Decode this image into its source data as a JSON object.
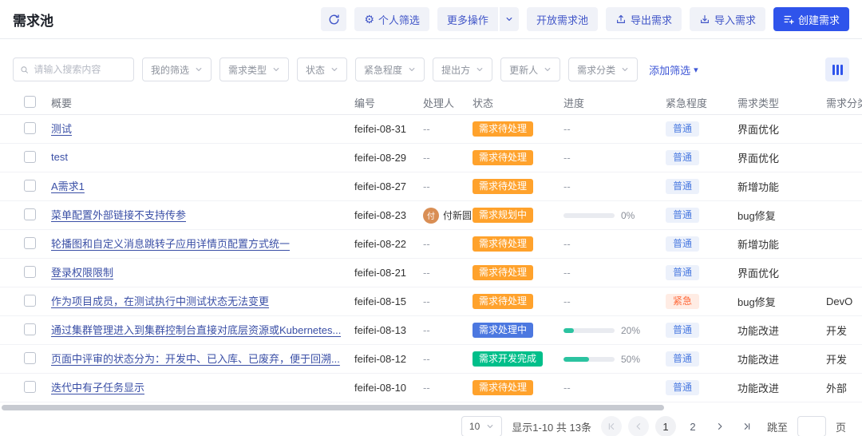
{
  "header": {
    "title": "需求池",
    "personal_filter": "个人筛选",
    "more_actions": "更多操作",
    "open_pool": "开放需求池",
    "export": "导出需求",
    "import": "导入需求",
    "create": "创建需求"
  },
  "filter_bar": {
    "search_placeholder": "请输入搜索内容",
    "dropdowns": [
      "我的筛选",
      "需求类型",
      "状态",
      "紧急程度",
      "提出方",
      "更新人",
      "需求分类"
    ],
    "add_filter": "添加筛选"
  },
  "table": {
    "columns": [
      "概要",
      "编号",
      "处理人",
      "状态",
      "进度",
      "紧急程度",
      "需求类型",
      "需求分类"
    ],
    "rows": [
      {
        "summary": "测试",
        "code": "feifei-08-31",
        "handler": "--",
        "status": "需求待处理",
        "status_type": "pending",
        "progress_text": "--",
        "urgency": "普通",
        "urgency_type": "normal",
        "req_type": "界面优化",
        "category": ""
      },
      {
        "summary": "test",
        "code": "feifei-08-29",
        "handler": "--",
        "status": "需求待处理",
        "status_type": "pending",
        "progress_text": "--",
        "urgency": "普通",
        "urgency_type": "normal",
        "req_type": "界面优化",
        "category": ""
      },
      {
        "summary": "A需求1",
        "code": "feifei-08-27",
        "handler": "--",
        "status": "需求待处理",
        "status_type": "pending",
        "progress_text": "--",
        "urgency": "普通",
        "urgency_type": "normal",
        "req_type": "新增功能",
        "category": ""
      },
      {
        "summary": "菜单配置外部链接不支持传参",
        "code": "feifei-08-23",
        "handler": "付新圆",
        "handler_initial": "付",
        "status": "需求规划中",
        "status_type": "planning",
        "progress_percent": 0,
        "progress_label": "0%",
        "urgency": "普通",
        "urgency_type": "normal",
        "req_type": "bug修复",
        "category": ""
      },
      {
        "summary": "轮播图和自定义消息跳转子应用详情页配置方式统一",
        "code": "feifei-08-22",
        "handler": "--",
        "status": "需求待处理",
        "status_type": "pending",
        "progress_text": "--",
        "urgency": "普通",
        "urgency_type": "normal",
        "req_type": "新增功能",
        "category": ""
      },
      {
        "summary": "登录权限限制",
        "code": "feifei-08-21",
        "handler": "--",
        "status": "需求待处理",
        "status_type": "pending",
        "progress_text": "--",
        "urgency": "普通",
        "urgency_type": "normal",
        "req_type": "界面优化",
        "category": ""
      },
      {
        "summary": "作为项目成员，在测试执行中测试状态无法变更",
        "code": "feifei-08-15",
        "handler": "--",
        "status": "需求待处理",
        "status_type": "pending",
        "progress_text": "--",
        "urgency": "紧急",
        "urgency_type": "urgent",
        "req_type": "bug修复",
        "category": "DevO"
      },
      {
        "summary": "通过集群管理进入到集群控制台直接对底层资源或Kubernetes...",
        "code": "feifei-08-13",
        "handler": "--",
        "status": "需求处理中",
        "status_type": "processing",
        "progress_percent": 20,
        "progress_label": "20%",
        "urgency": "普通",
        "urgency_type": "normal",
        "req_type": "功能改进",
        "category": "开发"
      },
      {
        "summary": "页面中评审的状态分为：开发中、已入库、已废弃，便于回溯...",
        "code": "feifei-08-12",
        "handler": "--",
        "status": "需求开发完成",
        "status_type": "done",
        "progress_percent": 50,
        "progress_label": "50%",
        "urgency": "普通",
        "urgency_type": "normal",
        "req_type": "功能改进",
        "category": "开发"
      },
      {
        "summary": "迭代中有子任务显示",
        "code": "feifei-08-10",
        "handler": "--",
        "status": "需求待处理",
        "status_type": "pending",
        "progress_text": "--",
        "urgency": "普通",
        "urgency_type": "normal",
        "req_type": "功能改进",
        "category": "外部"
      }
    ]
  },
  "pagination": {
    "page_size": "10",
    "summary": "显示1-10 共 13条",
    "page_1": "1",
    "page_2": "2",
    "jump_label": "跳至",
    "jump_unit": "页"
  },
  "icons": {
    "refresh-icon": "⟳",
    "gear-icon": "⚙",
    "chevron-down-icon": "∨",
    "caret-down-icon": "▾",
    "search-icon": "magnifier",
    "export-icon": "box-arrow-up",
    "import-icon": "box-arrow-down",
    "create-icon": "list-plus",
    "columns-icon": "vertical-bars",
    "first-page-icon": "|<",
    "prev-page-icon": "<",
    "next-page-icon": ">",
    "last-page-icon": ">|"
  },
  "colors": {
    "primary_blue": "#2f54eb",
    "action_button_bg": "#f0f2f8",
    "action_button_text": "#4156c8",
    "status_pending_bg": "#ffa22c",
    "status_processing_bg": "#4c78e0",
    "status_done_bg": "#00bf8a",
    "tag_normal_bg": "#ecf1fb",
    "tag_normal_text": "#4a7ae0",
    "tag_urgent_bg": "#ffece4",
    "tag_urgent_text": "#ff6a3b",
    "progress_fill": "#2bc3a0",
    "summary_link": "#3a4fa6"
  }
}
